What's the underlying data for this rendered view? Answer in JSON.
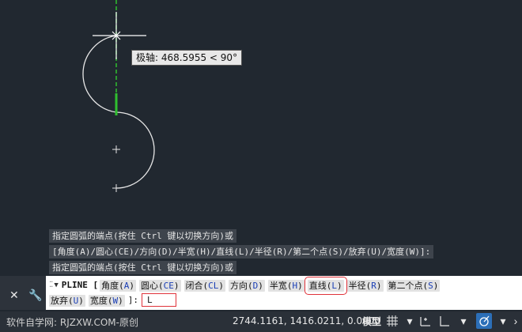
{
  "tooltip": {
    "text": "极轴: 468.5955 < 90°"
  },
  "history": [
    "指定圆弧的端点(按住 Ctrl 键以切换方向)或",
    "[角度(A)/圆心(CE)/方向(D)/半宽(H)/直线(L)/半径(R)/第二个点(S)/放弃(U)/宽度(W)]:",
    "指定圆弧的端点(按住 Ctrl 键以切换方向)或"
  ],
  "command": {
    "name": "PLINE [",
    "options_line1": [
      {
        "label": "角度(",
        "key": "A",
        "close": ")"
      },
      {
        "label": "圆心(",
        "key": "CE",
        "close": ")"
      },
      {
        "label": "闭合(",
        "key": "CL",
        "close": ")"
      },
      {
        "label": "方向(",
        "key": "D",
        "close": ")"
      },
      {
        "label": "半宽(",
        "key": "H",
        "close": ")"
      },
      {
        "label": "直线(",
        "key": "L",
        "close": ")"
      },
      {
        "label": "半径(",
        "key": "R",
        "close": ")"
      },
      {
        "label": "第二个点(",
        "key": "S",
        "close": ")"
      }
    ],
    "options_line2": [
      {
        "label": "放弃(",
        "key": "U",
        "close": ")"
      },
      {
        "label": "宽度(",
        "key": "W",
        "close": ")"
      }
    ],
    "suffix": "]:",
    "input_value": "L"
  },
  "side_buttons": {
    "close": "✕",
    "customize": "🔧"
  },
  "status": {
    "watermark": "软件自学网: RJZXW.COM-原创",
    "coords": "2744.1161, 1416.0211, 0.0000",
    "model_tab": "模型"
  },
  "icons": [
    "grip-icon",
    "dropdown-arrow-icon",
    "close-icon",
    "wrench-icon",
    "grid-icon",
    "snap-icon",
    "ortho-icon",
    "polar-icon"
  ],
  "colors": {
    "background": "#212830",
    "accent": "#e0323a",
    "polar_tracking": "#2fbf2f",
    "option_key": "#1b3fb5"
  }
}
